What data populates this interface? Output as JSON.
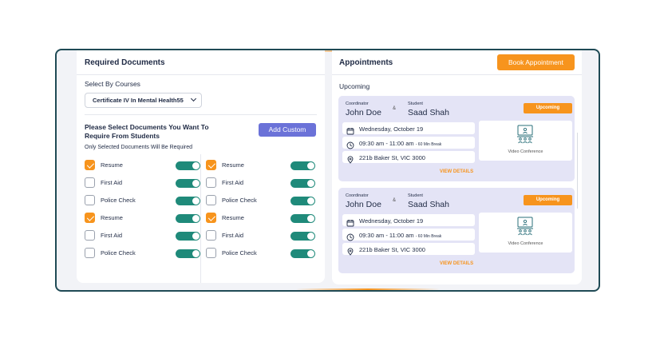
{
  "documents_panel": {
    "title": "Required Documents",
    "select_courses_label": "Select By Courses",
    "course_selected": "Certificate IV In Mental Health55",
    "question_line1": "Please Select Documents You Want To",
    "question_line2": "Require From Students",
    "add_custom_label": "Add Custom",
    "note": "Only Selected Documents Will Be Required",
    "left_column": [
      {
        "label": "Resume",
        "checked": true,
        "toggle_on": true
      },
      {
        "label": "First Aid",
        "checked": false,
        "toggle_on": true
      },
      {
        "label": "Police Check",
        "checked": false,
        "toggle_on": true
      },
      {
        "label": "Resume",
        "checked": true,
        "toggle_on": true
      },
      {
        "label": "First Aid",
        "checked": false,
        "toggle_on": true
      },
      {
        "label": "Police Check",
        "checked": false,
        "toggle_on": true
      }
    ],
    "right_column": [
      {
        "label": "Resume",
        "checked": true,
        "toggle_on": true
      },
      {
        "label": "First Aid",
        "checked": false,
        "toggle_on": true
      },
      {
        "label": "Police Check",
        "checked": false,
        "toggle_on": true
      },
      {
        "label": "Resume",
        "checked": true,
        "toggle_on": true
      },
      {
        "label": "First Aid",
        "checked": false,
        "toggle_on": true
      },
      {
        "label": "Police Check",
        "checked": false,
        "toggle_on": true
      }
    ]
  },
  "appointments_panel": {
    "title": "Appointments",
    "book_button_label": "Book Appointment",
    "section_label": "Upcoming",
    "cards": [
      {
        "coordinator_label": "Coordinator",
        "coordinator_name": "John Doe",
        "amp": "&",
        "student_label": "Student",
        "student_name": "Saad Shah",
        "status": "Upcoming",
        "date": "Wednesday, October 19",
        "time": "09:30 am - 11:00 am",
        "break_note": "- 60 Min Break",
        "location": "221b Baker St, VIC 3000",
        "meeting_type": "Video Conference",
        "view_details_label": "VIEW DETAILS"
      },
      {
        "coordinator_label": "Coordinator",
        "coordinator_name": "John Doe",
        "amp": "&",
        "student_label": "Student",
        "student_name": "Saad Shah",
        "status": "Upcoming",
        "date": "Wednesday, October 19",
        "time": "09:30 am - 11:00 am",
        "break_note": "- 60 Min Break",
        "location": "221b Baker St, VIC 3000",
        "meeting_type": "Video Conference",
        "view_details_label": "VIEW DETAILS"
      }
    ]
  },
  "icons": {
    "calendar": "calendar-icon",
    "clock": "clock-icon",
    "location": "location-pin-icon",
    "video": "video-conference-icon",
    "chevron": "chevron-down-icon"
  },
  "colors": {
    "accent_orange": "#f7941d",
    "button_purple": "#6b72d8",
    "toggle_teal": "#1f8a7a",
    "card_lavender": "#e4e4f6",
    "frame_border": "#1f4a55"
  }
}
